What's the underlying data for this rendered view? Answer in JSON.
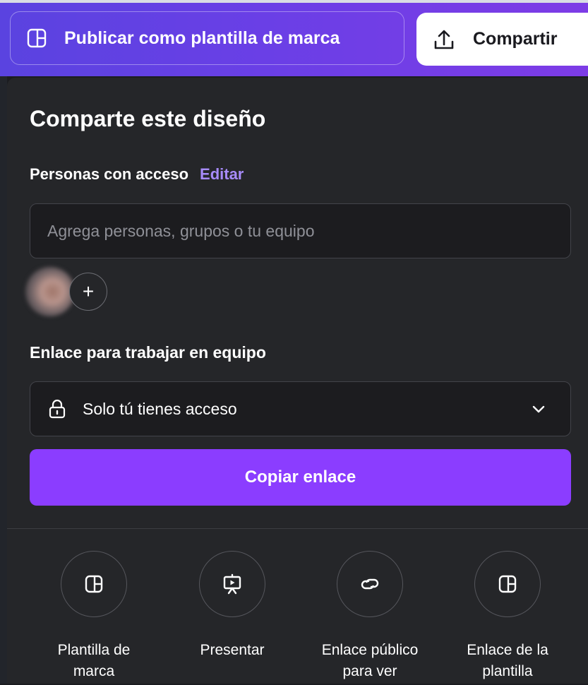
{
  "toolbar": {
    "publish_label": "Publicar como plantilla de marca",
    "share_label": "Compartir"
  },
  "share_panel": {
    "title": "Comparte este diseño",
    "people_access_label": "Personas con acceso",
    "edit_link": "Editar",
    "add_people_placeholder": "Agrega personas, grupos o tu equipo",
    "add_person_symbol": "+",
    "team_link_label": "Enlace para trabajar en equipo",
    "access_value": "Solo tú tienes acceso",
    "copy_link_label": "Copiar enlace"
  },
  "actions": [
    {
      "label": "Plantilla de\nmarca",
      "icon": "brand-template-icon"
    },
    {
      "label": "Presentar",
      "icon": "present-icon"
    },
    {
      "label": "Enlace público\npara ver",
      "icon": "link-icon"
    },
    {
      "label": "Enlace de la\nplantilla",
      "icon": "template-link-icon"
    }
  ],
  "colors": {
    "accent": "#8b3dff",
    "edit_link": "#a78bfa",
    "panel_bg": "#252629",
    "toolbar_gradient_start": "#5a43e0",
    "toolbar_gradient_end": "#7d3ce6"
  }
}
